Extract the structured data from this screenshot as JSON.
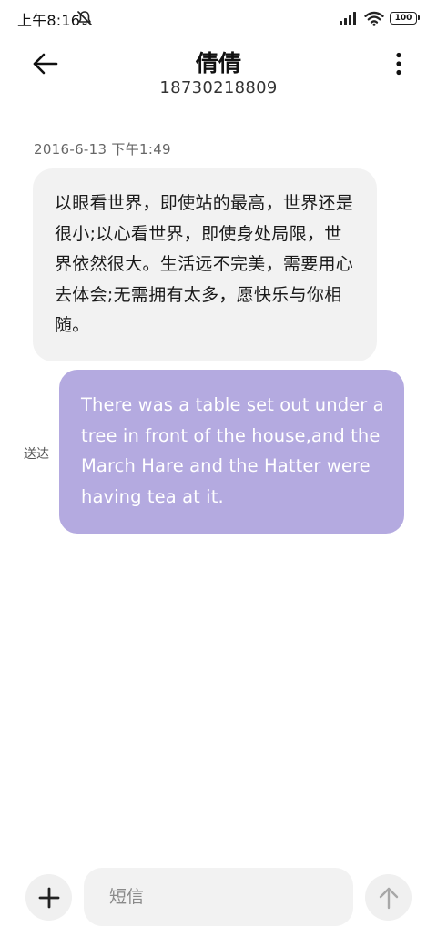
{
  "status_bar": {
    "time": "上午8:16",
    "battery": "100",
    "icons": [
      "mute-icon",
      "signal-icon",
      "wifi-icon",
      "battery-icon"
    ]
  },
  "header": {
    "back_icon": "arrow-left-icon",
    "contact_name": "倩倩",
    "contact_number": "18730218809",
    "more_icon": "more-vertical-icon"
  },
  "conversation": {
    "timestamp": "2016-6-13 下午1:49",
    "messages": [
      {
        "direction": "incoming",
        "text": "以眼看世界，即使站的最高，世界还是很小;以心看世界，即使身处局限，世界依然很大。生活远不完美，需要用心去体会;无需拥有太多，愿快乐与你相随。"
      },
      {
        "direction": "outgoing",
        "text": "There was a table set out under a tree in front of the house,and the March Hare and the Hatter were having tea at it.",
        "status": "送达"
      }
    ]
  },
  "composer": {
    "add_icon": "plus-icon",
    "placeholder": "短信",
    "value": "",
    "send_icon": "arrow-up-icon"
  },
  "colors": {
    "incoming_bubble": "#f2f2f2",
    "outgoing_bubble": "#b4aae0",
    "outgoing_text": "#ffffff",
    "button_background": "#f0f0f0"
  }
}
